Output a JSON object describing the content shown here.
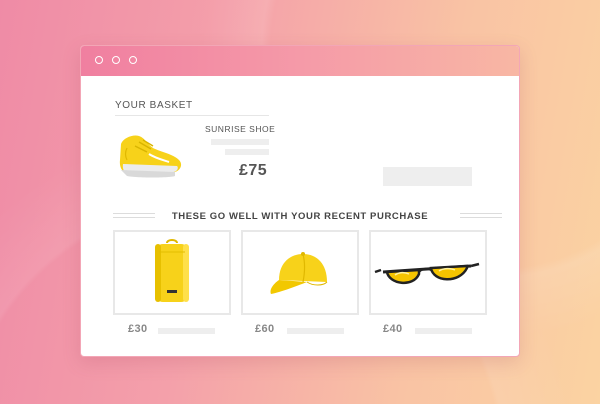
{
  "window": {
    "controls": [
      "dot-1",
      "dot-2",
      "dot-3"
    ]
  },
  "basket": {
    "label": "YOUR BASKET",
    "item": {
      "name": "SUNRISE SHOE",
      "price": "£75",
      "image_icon": "sneaker-icon"
    }
  },
  "recommendations": {
    "heading": "THESE GO WELL WITH YOUR RECENT PURCHASE",
    "items": [
      {
        "icon": "backpack-icon",
        "price": "£30"
      },
      {
        "icon": "cap-icon",
        "price": "£60"
      },
      {
        "icon": "sunglasses-icon",
        "price": "£40"
      }
    ]
  },
  "colors": {
    "product_yellow": "#f7d21a",
    "titlebar_start": "#f07fa0",
    "titlebar_end": "#f8b7a4"
  }
}
